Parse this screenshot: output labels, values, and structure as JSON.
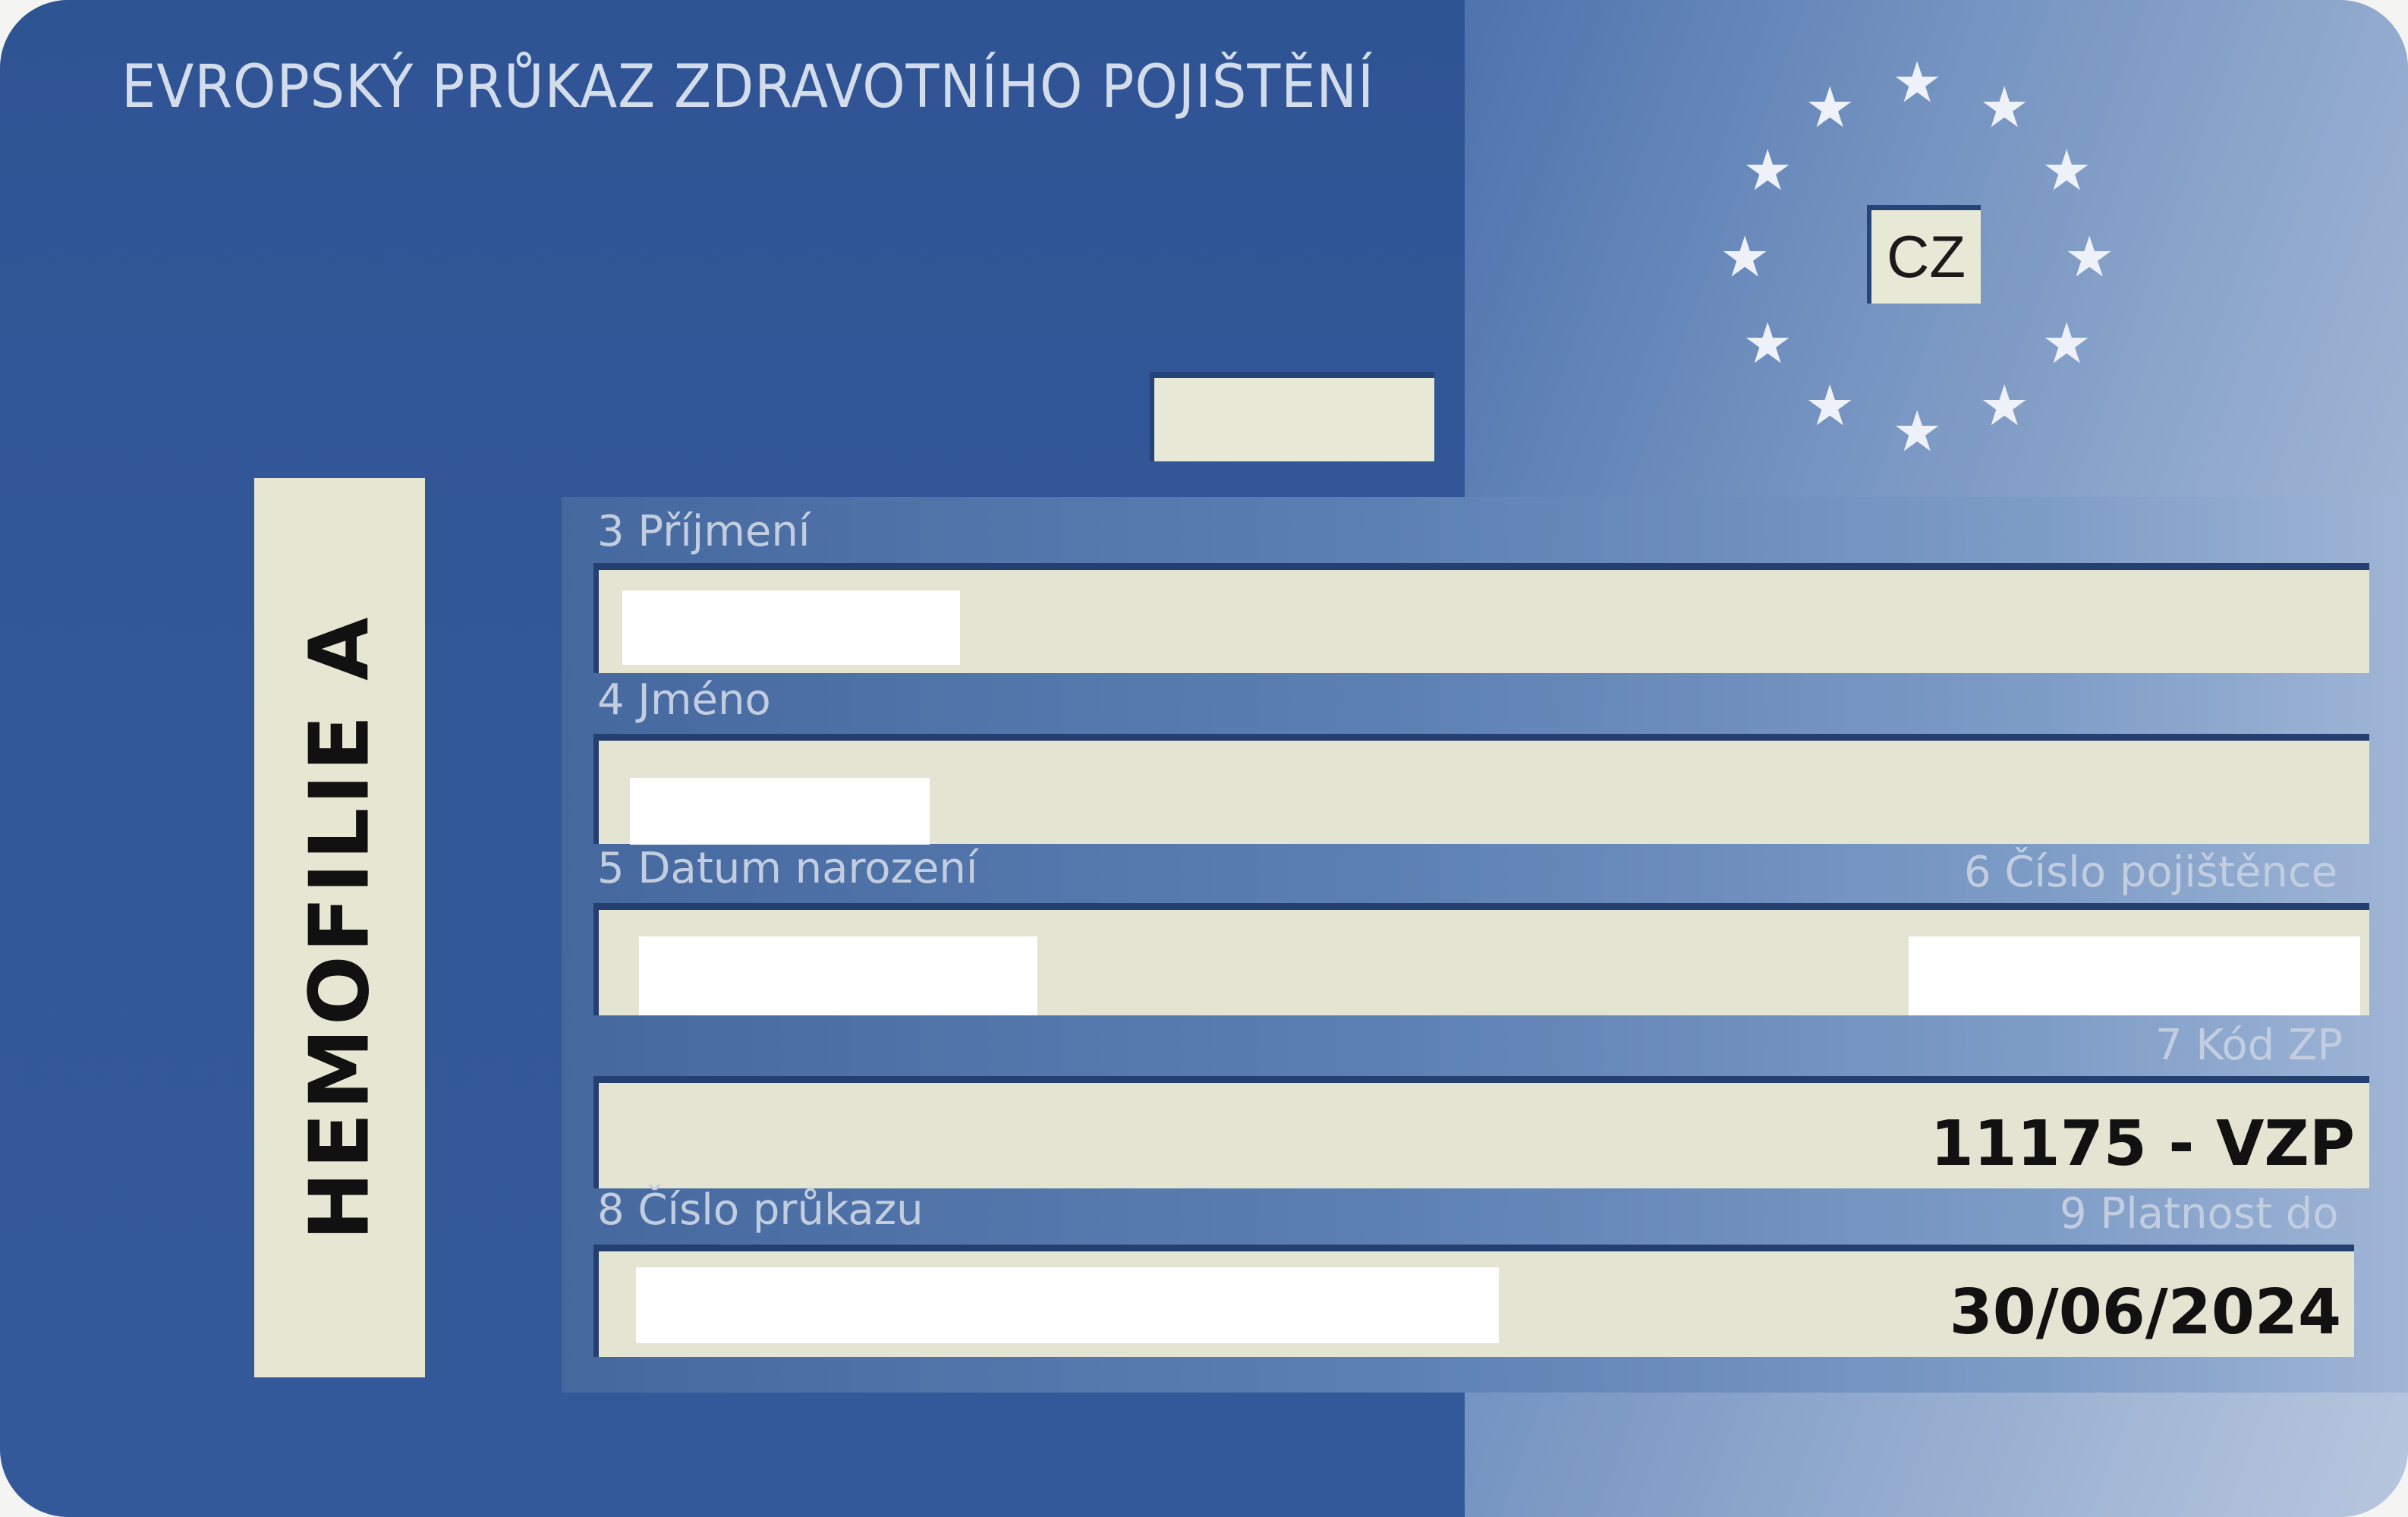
{
  "card": {
    "title": "EVROPSKÝ PRŮKAZ ZDRAVOTNÍHO POJIŠTĚNÍ",
    "country_code": "CZ",
    "side_label": "HEMOFILIE  A"
  },
  "fields": {
    "surname_label": "3 Příjmení",
    "given_name_label": "4 Jméno",
    "birth_date_label": "5 Datum narození",
    "insured_number_label": "6 Číslo pojištěnce",
    "insurer_code_label": "7 Kód ZP",
    "insurer_code_value": "11175 - VZP",
    "card_number_label": "8 Číslo průkazu",
    "valid_until_label": "9 Platnost do",
    "valid_until_value": "30/06/2024"
  },
  "icons": {
    "eu_star": "★",
    "eu_flag": "eu-flag-icon"
  },
  "colors": {
    "card_dark_blue": "#2f5494",
    "card_light_blue": "#a4b8d6",
    "field_background": "#e3e4d1",
    "redaction": "#ffffff"
  }
}
